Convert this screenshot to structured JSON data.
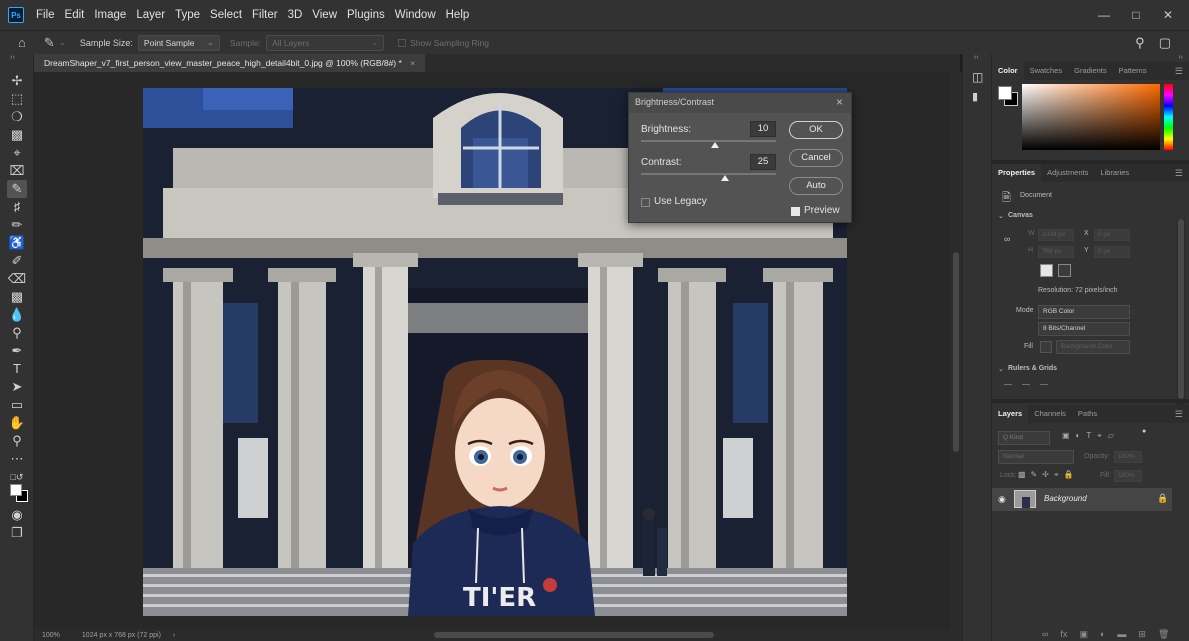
{
  "app": {
    "logo": "Ps"
  },
  "menu": {
    "items": [
      "File",
      "Edit",
      "Image",
      "Layer",
      "Type",
      "Select",
      "Filter",
      "3D",
      "View",
      "Plugins",
      "Window",
      "Help"
    ]
  },
  "window_controls": {
    "minimize": "—",
    "maximize": "□",
    "close": "✕"
  },
  "options_bar": {
    "sample_size_label": "Sample Size:",
    "sample_size_value": "Point Sample",
    "sample_label": "Sample:",
    "sample_value": "All Layers",
    "show_ring_label": "Show Sampling Ring"
  },
  "document": {
    "tab_title": "DreamShaper_v7_first_person_view_master_peace_high_detail4bit_0.jpg @ 100% (RGB/8#) *",
    "tab_close": "×",
    "zoom": "100%",
    "dimensions": "1024 px x 768 px (72 ppi)"
  },
  "artwork": {
    "hoodie_text": "TI'ER"
  },
  "dialog": {
    "title": "Brightness/Contrast",
    "brightness_label": "Brightness:",
    "brightness_value": "10",
    "contrast_label": "Contrast:",
    "contrast_value": "25",
    "ok_label": "OK",
    "cancel_label": "Cancel",
    "auto_label": "Auto",
    "legacy_label": "Use Legacy",
    "legacy_checked": false,
    "preview_label": "Preview",
    "preview_checked": true,
    "brightness_frac": 0.55,
    "contrast_frac": 0.62
  },
  "color_panel": {
    "tabs": [
      "Color",
      "Swatches",
      "Gradients",
      "Patterns"
    ],
    "active_tab": "Color",
    "fg_color": "#ffffff",
    "bg_color": "#000000",
    "hue_color": "#ff6a00"
  },
  "properties_panel": {
    "tabs": [
      "Properties",
      "Adjustments",
      "Libraries"
    ],
    "active_tab": "Properties",
    "doc_label": "Document",
    "canvas_section": "Canvas",
    "w_label": "W",
    "w_value": "1024 px",
    "x_label": "X",
    "x_value": "0 px",
    "h_label": "H",
    "h_value": "768 px",
    "y_label": "Y",
    "y_value": "0 px",
    "resolution": "Resolution: 72 pixels/inch",
    "mode_label": "Mode",
    "mode_value": "RGB Color",
    "bits_value": "8 Bits/Channel",
    "fill_label": "Fill",
    "fill_value": "Background Color",
    "rulers_section": "Rulers & Grids"
  },
  "layers_panel": {
    "tabs": [
      "Layers",
      "Channels",
      "Paths"
    ],
    "active_tab": "Layers",
    "search_placeholder": "Q Kind",
    "blend_mode": "Normal",
    "opacity_label": "Opacity:",
    "opacity_value": "100%",
    "lock_label": "Lock:",
    "fill_label": "Fill:",
    "fill_value": "100%",
    "layer_name": "Background"
  }
}
